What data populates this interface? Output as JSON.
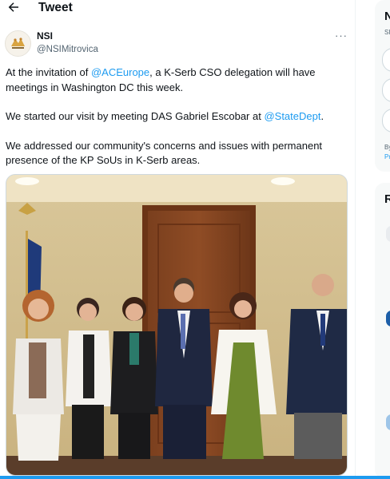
{
  "header": {
    "title": "Tweet",
    "back_icon": "arrow-left-icon"
  },
  "tweet": {
    "author_name": "NSI",
    "author_handle": "@NSIMitrovica",
    "more_icon": "more-horizontal-icon",
    "more_label": "···",
    "paragraph1": {
      "before": "At the invitation of ",
      "mention": "@ACEurope",
      "after": ", a K-Serb CSO delegation will have meetings in Washington DC this week."
    },
    "paragraph2": {
      "before": "We started our visit by meeting DAS Gabriel Escobar at ",
      "mention": "@StateDept",
      "after": "."
    },
    "paragraph3": {
      "text": "We addressed our community's concerns and issues with permanent presence of the KP SoUs in K-Serb areas."
    }
  },
  "sidebar": {
    "card1_title": "N",
    "card1_sub": "SI",
    "card1_footer1": "By",
    "card1_footer2": "Pr",
    "card2_title": "R"
  },
  "colors": {
    "link": "#1d9bf0",
    "text": "#0f1419",
    "secondary": "#536471",
    "accent_bar": "#1d9bf0"
  }
}
